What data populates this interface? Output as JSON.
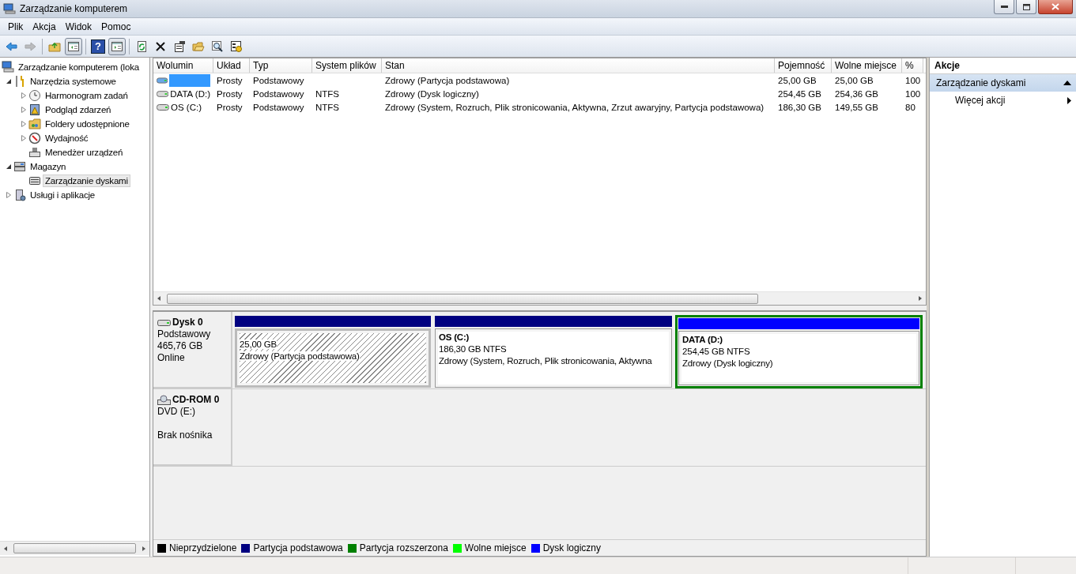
{
  "window": {
    "title": "Zarządzanie komputerem"
  },
  "menu": [
    "Plik",
    "Akcja",
    "Widok",
    "Pomoc"
  ],
  "toolbar": [
    {
      "pressed": false,
      "disabled": false
    },
    {
      "pressed": false,
      "disabled": true
    },
    {
      "pressed": false,
      "disabled": false
    },
    {
      "pressed": true,
      "disabled": false
    },
    {
      "pressed": false,
      "disabled": false,
      "glyph": "?"
    },
    {
      "pressed": true,
      "disabled": false
    },
    {
      "pressed": false,
      "disabled": false
    },
    {
      "pressed": false,
      "disabled": false
    },
    {
      "pressed": false,
      "disabled": false
    },
    {
      "pressed": false,
      "disabled": false
    },
    {
      "pressed": false,
      "disabled": false
    },
    {
      "pressed": false,
      "disabled": false
    }
  ],
  "tree": [
    {
      "label": "Zarządzanie komputerem (loka",
      "selected": false,
      "children": [
        {
          "label": "Narzędzia systemowe",
          "expanded": true,
          "selected": false,
          "children": [
            {
              "label": "Harmonogram zadań",
              "expanded": false,
              "selected": false
            },
            {
              "label": "Podgląd zdarzeń",
              "expanded": false,
              "selected": false
            },
            {
              "label": "Foldery udostępnione",
              "expanded": false,
              "selected": false
            },
            {
              "label": "Wydajność",
              "expanded": false,
              "selected": false
            },
            {
              "label": "Menedżer urządzeń",
              "selected": false
            }
          ]
        },
        {
          "label": "Magazyn",
          "expanded": true,
          "selected": false,
          "children": [
            {
              "label": "Zarządzanie dyskami",
              "selected": true
            }
          ]
        },
        {
          "label": "Usługi i aplikacje",
          "expanded": false,
          "selected": false
        }
      ]
    }
  ],
  "table": {
    "columns": [
      "Wolumin",
      "Układ",
      "Typ",
      "System plików",
      "Stan",
      "Pojemność",
      "Wolne miejsce",
      "%"
    ],
    "rows": [
      {
        "selected": true,
        "cells": [
          "",
          "Prosty",
          "Podstawowy",
          "",
          "Zdrowy (Partycja podstawowa)",
          "25,00 GB",
          "25,00 GB",
          "100"
        ]
      },
      {
        "selected": false,
        "cells": [
          "DATA (D:)",
          "Prosty",
          "Podstawowy",
          "NTFS",
          "Zdrowy (Dysk logiczny)",
          "254,45 GB",
          "254,36 GB",
          "100"
        ]
      },
      {
        "selected": false,
        "cells": [
          "OS (C:)",
          "Prosty",
          "Podstawowy",
          "NTFS",
          "Zdrowy (System, Rozruch, Plik stronicowania, Aktywna, Zrzut awaryjny, Partycja podstawowa)",
          "186,30 GB",
          "149,55 GB",
          "80"
        ]
      }
    ]
  },
  "disks": [
    {
      "kind": "disk",
      "name": "Dysk 0",
      "type": "Podstawowy",
      "size": "465,76 GB",
      "status": "Online",
      "partitions": [
        {
          "kind": "primary",
          "selected": true,
          "size": "25,00 GB",
          "status": "Zdrowy (Partycja podstawowa)"
        },
        {
          "kind": "primary",
          "selected": false,
          "title": "OS  (C:)",
          "size": "186,30 GB NTFS",
          "status": "Zdrowy (System, Rozruch, Plik stronicowania, Aktywna"
        },
        {
          "kind": "logical",
          "selected": false,
          "title": "DATA  (D:)",
          "size": "254,45 GB NTFS",
          "status": "Zdrowy (Dysk logiczny)"
        }
      ]
    },
    {
      "kind": "cdrom",
      "name": "CD-ROM 0",
      "type": "DVD (E:)",
      "status": "Brak nośnika"
    }
  ],
  "legend": [
    {
      "label": "Nieprzydzielone",
      "color": "#000000"
    },
    {
      "label": "Partycja podstawowa",
      "color": "#000080"
    },
    {
      "label": "Partycja rozszerzona",
      "color": "#008000"
    },
    {
      "label": "Wolne miejsce",
      "color": "#00ff00"
    },
    {
      "label": "Dysk logiczny",
      "color": "#0000ff"
    }
  ],
  "actions": {
    "title": "Akcje",
    "sections": [
      {
        "label": "Zarządzanie dyskami",
        "expanded": true,
        "items": [
          "Więcej akcji"
        ]
      }
    ]
  }
}
